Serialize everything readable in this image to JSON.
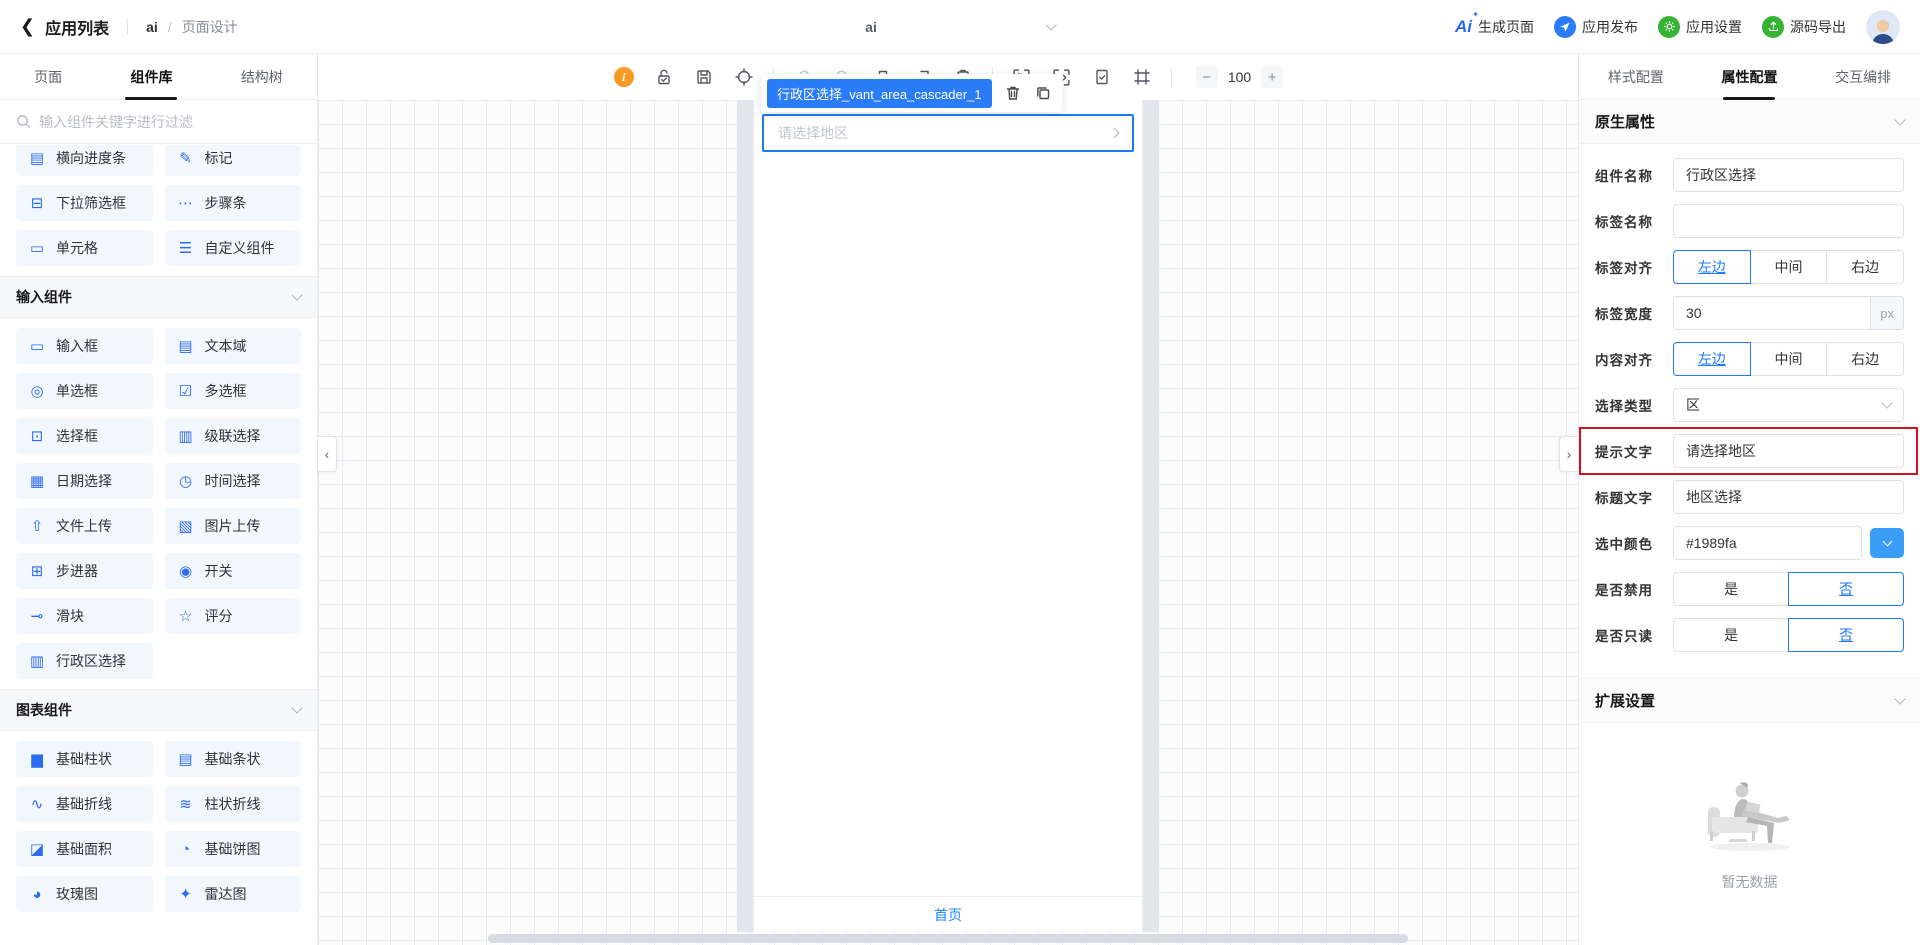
{
  "topbar": {
    "back_label": "应用列表",
    "breadcrumb": {
      "app": "ai",
      "separator": "/",
      "page": "页面设计"
    },
    "page_select_value": "ai",
    "actions": {
      "generate": "生成页面",
      "publish": "应用发布",
      "settings": "应用设置",
      "export": "源码导出"
    },
    "colors": {
      "publish": "#2b7cf8",
      "settings": "#35b434",
      "export": "#35b434",
      "ai_logo": "#2968f6"
    }
  },
  "left_panel": {
    "tabs": [
      {
        "label": "页面",
        "active": false
      },
      {
        "label": "组件库",
        "active": true
      },
      {
        "label": "结构树",
        "active": false
      }
    ],
    "search_placeholder": "输入组件关键字进行过滤",
    "top_items": [
      {
        "label": "横向进度条",
        "icon": "horizontal-progress-icon"
      },
      {
        "label": "标记",
        "icon": "marker-icon"
      },
      {
        "label": "下拉筛选框",
        "icon": "dropdown-filter-icon"
      },
      {
        "label": "步骤条",
        "icon": "steps-icon"
      },
      {
        "label": "单元格",
        "icon": "cell-icon"
      },
      {
        "label": "自定义组件",
        "icon": "custom-component-icon"
      }
    ],
    "sections": [
      {
        "title": "输入组件",
        "items": [
          {
            "label": "输入框",
            "icon": "input-icon"
          },
          {
            "label": "文本域",
            "icon": "textarea-icon"
          },
          {
            "label": "单选框",
            "icon": "radio-icon"
          },
          {
            "label": "多选框",
            "icon": "checkbox-icon"
          },
          {
            "label": "选择框",
            "icon": "select-icon"
          },
          {
            "label": "级联选择",
            "icon": "cascader-icon"
          },
          {
            "label": "日期选择",
            "icon": "date-picker-icon"
          },
          {
            "label": "时间选择",
            "icon": "time-picker-icon"
          },
          {
            "label": "文件上传",
            "icon": "file-upload-icon"
          },
          {
            "label": "图片上传",
            "icon": "image-upload-icon"
          },
          {
            "label": "步进器",
            "icon": "stepper-icon"
          },
          {
            "label": "开关",
            "icon": "switch-icon"
          },
          {
            "label": "滑块",
            "icon": "slider-icon"
          },
          {
            "label": "评分",
            "icon": "rate-icon"
          },
          {
            "label": "行政区选择",
            "icon": "area-cascader-icon"
          }
        ]
      },
      {
        "title": "图表组件",
        "items": [
          {
            "label": "基础柱状",
            "icon": "bar-chart-icon"
          },
          {
            "label": "基础条状",
            "icon": "horizontal-bar-chart-icon"
          },
          {
            "label": "基础折线",
            "icon": "line-chart-icon"
          },
          {
            "label": "柱状折线",
            "icon": "bar-line-chart-icon"
          },
          {
            "label": "基础面积",
            "icon": "area-chart-icon"
          },
          {
            "label": "基础饼图",
            "icon": "pie-chart-icon"
          },
          {
            "label": "玫瑰图",
            "icon": "rose-chart-icon"
          },
          {
            "label": "雷达图",
            "icon": "radar-chart-icon"
          }
        ]
      }
    ]
  },
  "toolbar": {
    "zoom_value": "100",
    "zoom_out": "−",
    "zoom_in": "+",
    "icon_names": [
      "info-icon",
      "unlock-icon",
      "save-icon",
      "target-icon",
      "undo-icon",
      "redo-icon",
      "printer-icon",
      "import-icon",
      "paste-icon",
      "refresh-scan-icon",
      "code-scan-icon",
      "doc-check-icon",
      "frame-icon"
    ]
  },
  "canvas": {
    "selected_component_label": "行政区选择_vant_area_cascader_1",
    "cascader_placeholder": "请选择地区",
    "tabbar_item": "首页"
  },
  "right_panel": {
    "tabs": [
      {
        "label": "样式配置",
        "active": false
      },
      {
        "label": "属性配置",
        "active": true
      },
      {
        "label": "交互编排",
        "active": false
      }
    ],
    "native_section_title": "原生属性",
    "extension_section_title": "扩展设置",
    "fields": {
      "component_name": {
        "label": "组件名称",
        "value": "行政区选择"
      },
      "tag_name": {
        "label": "标签名称",
        "value": ""
      },
      "label_align": {
        "label": "标签对齐",
        "options": [
          "左边",
          "中间",
          "右边"
        ],
        "selected": "左边"
      },
      "label_width": {
        "label": "标签宽度",
        "value": "30",
        "unit": "px"
      },
      "content_align": {
        "label": "内容对齐",
        "options": [
          "左边",
          "中间",
          "右边"
        ],
        "selected": "左边"
      },
      "select_type": {
        "label": "选择类型",
        "value": "区"
      },
      "placeholder_text": {
        "label": "提示文字",
        "value": "请选择地区",
        "highlighted": true
      },
      "title_text": {
        "label": "标题文字",
        "value": "地区选择"
      },
      "selected_color": {
        "label": "选中颜色",
        "value": "#1989fa"
      },
      "disabled": {
        "label": "是否禁用",
        "options": [
          "是",
          "否"
        ],
        "selected": "否"
      },
      "readonly": {
        "label": "是否只读",
        "options": [
          "是",
          "否"
        ],
        "selected": "否"
      }
    },
    "empty_text": "暂无数据",
    "accent_color": "#1989fa",
    "highlight_color": "#cf1322"
  }
}
